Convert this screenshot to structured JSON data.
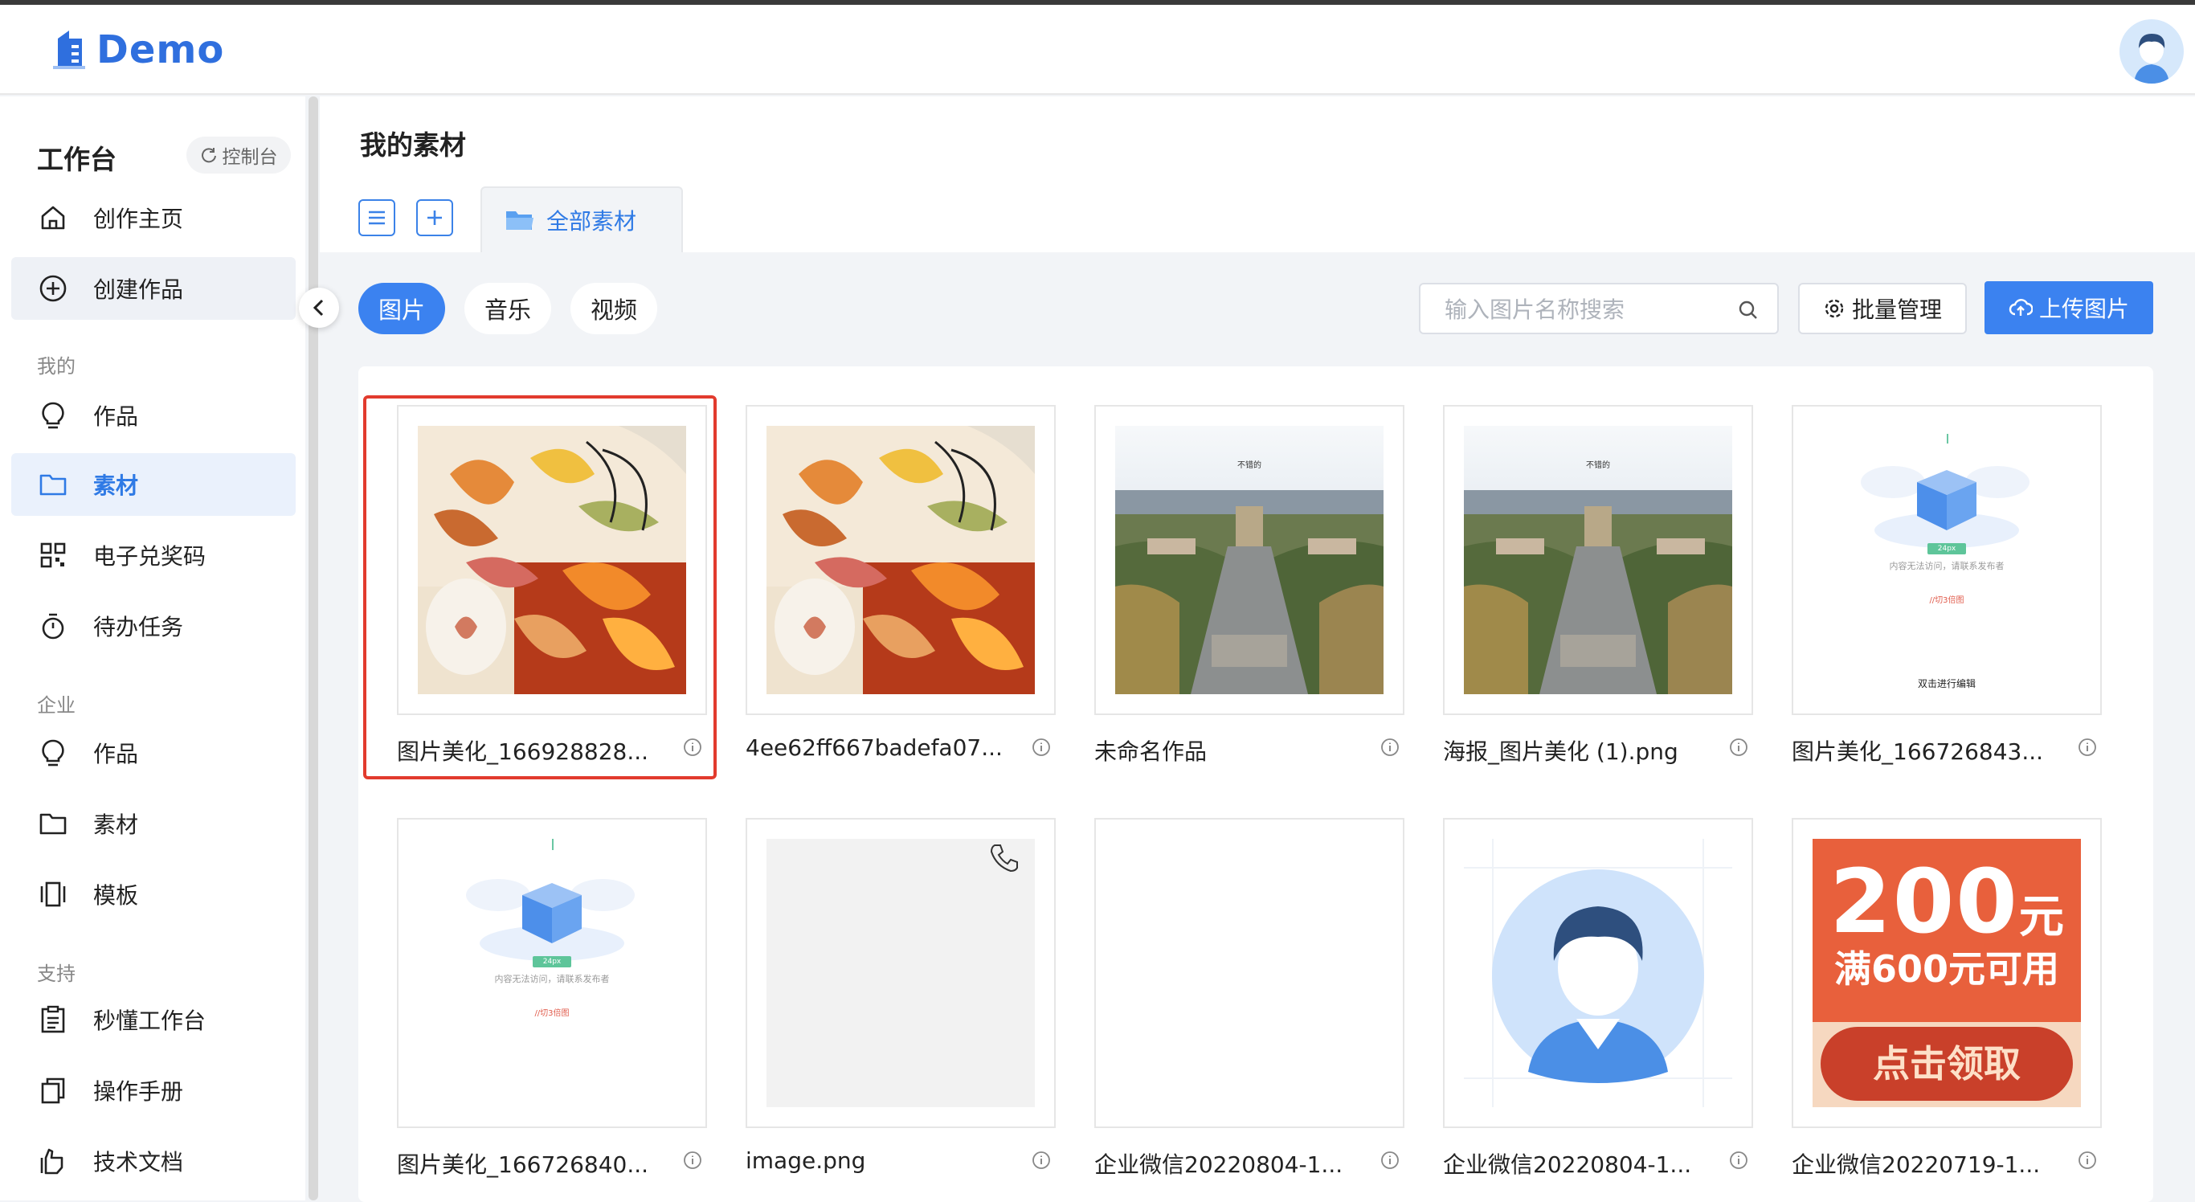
{
  "app": {
    "logo_text": "Demo"
  },
  "sidebar": {
    "title": "工作台",
    "console_label": "控制台",
    "items": [
      {
        "label": "创作主页",
        "icon": "home-icon"
      },
      {
        "label": "创建作品",
        "icon": "plus-circle-icon"
      }
    ],
    "sections": [
      {
        "title": "我的",
        "items": [
          {
            "label": "作品",
            "icon": "bulb-icon"
          },
          {
            "label": "素材",
            "icon": "folder-icon"
          },
          {
            "label": "电子兑奖码",
            "icon": "qrcode-icon"
          },
          {
            "label": "待办任务",
            "icon": "timer-icon"
          }
        ]
      },
      {
        "title": "企业",
        "items": [
          {
            "label": "作品",
            "icon": "bulb-icon"
          },
          {
            "label": "素材",
            "icon": "folder-icon"
          },
          {
            "label": "模板",
            "icon": "template-icon"
          }
        ]
      },
      {
        "title": "支持",
        "items": [
          {
            "label": "秒懂工作台",
            "icon": "clipboard-icon"
          },
          {
            "label": "操作手册",
            "icon": "copy-icon"
          },
          {
            "label": "技术文档",
            "icon": "hand-icon"
          }
        ]
      }
    ]
  },
  "main": {
    "page_title": "我的素材",
    "folder_tab": "全部素材",
    "filters": [
      "图片",
      "音乐",
      "视频"
    ],
    "active_filter": "图片",
    "search_placeholder": "输入图片名称搜索",
    "batch_label": "批量管理",
    "upload_label": "上传图片",
    "items": [
      {
        "name": "图片美化_166928828...",
        "thumb": "autumn-leaves",
        "selected": true
      },
      {
        "name": "4ee62ff667badefa07...",
        "thumb": "autumn-leaves"
      },
      {
        "name": "未命名作品",
        "thumb": "campus-aerial",
        "caption": "不错的"
      },
      {
        "name": "海报_图片美化 (1).png",
        "thumb": "campus-aerial",
        "caption": "不错的"
      },
      {
        "name": "图片美化_166726843...",
        "thumb": "empty-box",
        "box_badge": "24px",
        "box_line1": "内容无法访问，请联系发布者",
        "box_line2": "//切3倍图",
        "box_footer": "双击进行编辑"
      },
      {
        "name": "图片美化_166726840...",
        "thumb": "empty-box",
        "box_badge": "24px",
        "box_line1": "内容无法访问，请联系发布者",
        "box_line2": "//切3倍图"
      },
      {
        "name": "image.png",
        "thumb": "phone-grey"
      },
      {
        "name": "企业微信20220804-1...",
        "thumb": "blank"
      },
      {
        "name": "企业微信20220804-1...",
        "thumb": "avatar"
      },
      {
        "name": "企业微信20220719-1...",
        "thumb": "coupon",
        "coupon_amount": "200",
        "coupon_unit": "元",
        "coupon_condition": "满600元可用",
        "coupon_button": "点击领取"
      }
    ]
  },
  "colors": {
    "accent": "#3b82f0",
    "selected_border": "#e23b2e",
    "coupon_orange": "#e8603c"
  }
}
